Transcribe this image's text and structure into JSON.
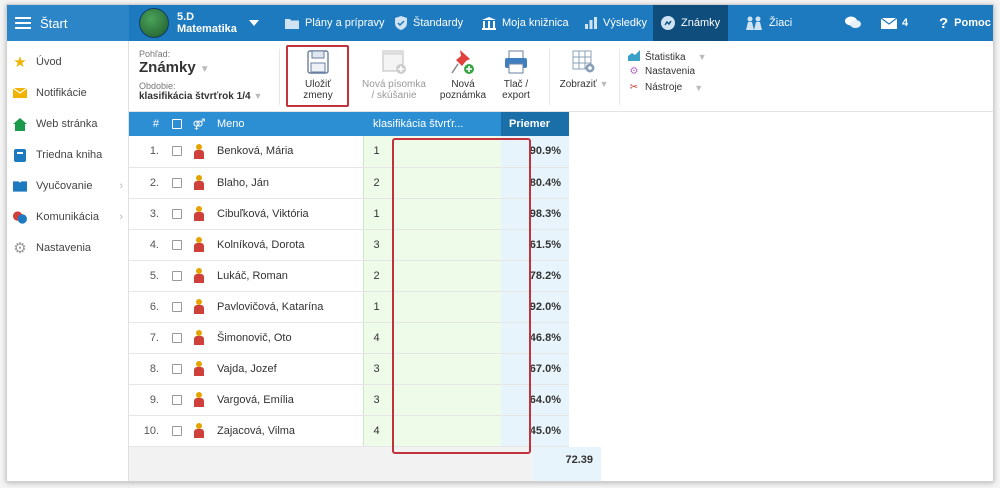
{
  "topbar": {
    "start": "Štart",
    "class_name": "5.D",
    "subject": "Matematika",
    "nav": [
      {
        "label": "Plány a prípravy",
        "icon": "folder-icon"
      },
      {
        "label": "Štandardy",
        "icon": "shield-icon"
      },
      {
        "label": "Moja knižnica",
        "icon": "library-icon"
      },
      {
        "label": "Výsledky",
        "icon": "bar-chart-icon"
      },
      {
        "label": "Známky",
        "icon": "grades-icon"
      },
      {
        "label": "Žiaci",
        "icon": "students-icon"
      }
    ],
    "messages_count": "4",
    "help": "Pomoc"
  },
  "sidebar": {
    "items": [
      {
        "label": "Úvod",
        "icon": "star-icon",
        "color": "#f0b400"
      },
      {
        "label": "Notifikácie",
        "icon": "envelope-icon",
        "color": "#f0b400"
      },
      {
        "label": "Web stránka",
        "icon": "home-icon",
        "color": "#1a9a4a"
      },
      {
        "label": "Triedna kniha",
        "icon": "book-icon",
        "color": "#1d7abf"
      },
      {
        "label": "Vyučovanie",
        "icon": "open-book-icon",
        "color": "#1d7abf"
      },
      {
        "label": "Komunikácia",
        "icon": "chat-icon",
        "color": "#d0403a"
      },
      {
        "label": "Nastavenia",
        "icon": "gear-icon",
        "color": "#999999"
      }
    ]
  },
  "toolbar": {
    "view_label": "Pohľad:",
    "view_value": "Známky",
    "period_label": "Obdobie:",
    "period_value": "klasifikácia štvrťrok 1/4",
    "save_line1": "Uložiť",
    "save_line2": "zmeny",
    "new_test_line1": "Nová písomka",
    "new_test_line2": "/ skúšanie",
    "new_note_line1": "Nová",
    "new_note_line2": "poznámka",
    "print_line1": "Tlač /",
    "print_line2": "export",
    "show": "Zobraziť",
    "statistics": "Štatistika",
    "settings": "Nastavenia",
    "tools": "Nástroje"
  },
  "table": {
    "headers": {
      "num": "#",
      "name": "Meno",
      "grade": "klasifikácia štvrťr...",
      "avg": "Priemer"
    },
    "rows": [
      {
        "num": "1.",
        "name": "Benková, Mária",
        "grade": "1",
        "avg": "90.9%"
      },
      {
        "num": "2.",
        "name": "Blaho, Ján",
        "grade": "2",
        "avg": "80.4%"
      },
      {
        "num": "3.",
        "name": "Cibuľková, Viktória",
        "grade": "1",
        "avg": "98.3%"
      },
      {
        "num": "4.",
        "name": "Kolníková, Dorota",
        "grade": "3",
        "avg": "61.5%"
      },
      {
        "num": "5.",
        "name": "Lukáč, Roman",
        "grade": "2",
        "avg": "78.2%"
      },
      {
        "num": "6.",
        "name": "Pavlovičová, Katarína",
        "grade": "1",
        "avg": "92.0%"
      },
      {
        "num": "7.",
        "name": "Šimonovič, Oto",
        "grade": "4",
        "avg": "46.8%"
      },
      {
        "num": "8.",
        "name": "Vajda, Jozef",
        "grade": "3",
        "avg": "67.0%"
      },
      {
        "num": "9.",
        "name": "Vargová, Emília",
        "grade": "3",
        "avg": "64.0%"
      },
      {
        "num": "10.",
        "name": "Zajacová, Vilma",
        "grade": "4",
        "avg": "45.0%"
      }
    ],
    "total_avg": "72.39"
  }
}
